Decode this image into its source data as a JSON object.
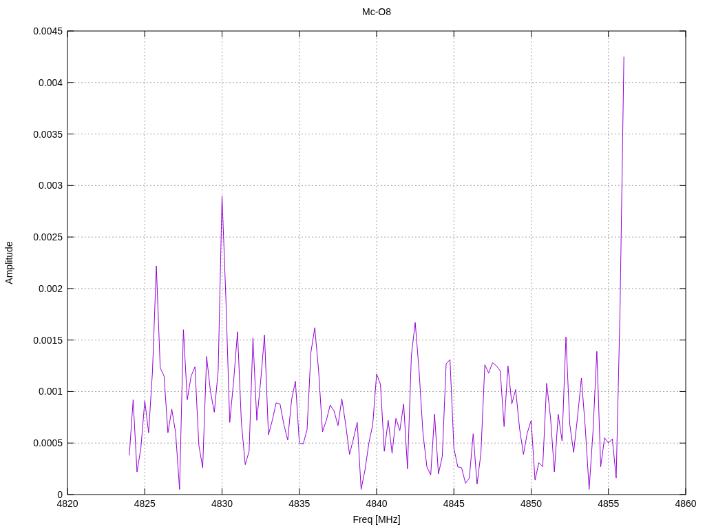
{
  "chart": {
    "chart_data": {
      "type": "line",
      "title": "Mc-O8",
      "xlabel": "Freq [MHz]",
      "ylabel": "Amplitude",
      "grid": true,
      "xlim": [
        4820,
        4860
      ],
      "ylim": [
        0,
        0.0045
      ],
      "xticks": [
        4820,
        4825,
        4830,
        4835,
        4840,
        4845,
        4850,
        4855,
        4860
      ],
      "yticks": [
        0,
        0.0005,
        0.001,
        0.0015,
        0.002,
        0.0025,
        0.003,
        0.0035,
        0.004,
        0.0045
      ],
      "x": [
        4824,
        4824.25,
        4824.5,
        4824.75,
        4825,
        4825.25,
        4825.5,
        4825.75,
        4826,
        4826.25,
        4826.5,
        4826.75,
        4827,
        4827.25,
        4827.5,
        4827.75,
        4828,
        4828.25,
        4828.5,
        4828.75,
        4829,
        4829.25,
        4829.5,
        4829.75,
        4830,
        4830.25,
        4830.5,
        4830.75,
        4831,
        4831.25,
        4831.5,
        4831.75,
        4832,
        4832.25,
        4832.5,
        4832.75,
        4833,
        4833.25,
        4833.5,
        4833.75,
        4834,
        4834.25,
        4834.5,
        4834.75,
        4835,
        4835.25,
        4835.5,
        4835.75,
        4836,
        4836.25,
        4836.5,
        4836.75,
        4837,
        4837.25,
        4837.5,
        4837.75,
        4838,
        4838.25,
        4838.5,
        4838.75,
        4839,
        4839.25,
        4839.5,
        4839.75,
        4840,
        4840.25,
        4840.5,
        4840.75,
        4841,
        4841.25,
        4841.5,
        4841.75,
        4842,
        4842.25,
        4842.5,
        4842.75,
        4843,
        4843.25,
        4843.5,
        4843.75,
        4844,
        4844.25,
        4844.5,
        4844.75,
        4845,
        4845.25,
        4845.5,
        4845.75,
        4846,
        4846.25,
        4846.5,
        4846.75,
        4847,
        4847.25,
        4847.5,
        4847.75,
        4848,
        4848.25,
        4848.5,
        4848.75,
        4849,
        4849.25,
        4849.5,
        4849.75,
        4850,
        4850.25,
        4850.5,
        4850.75,
        4851,
        4851.25,
        4851.5,
        4851.75,
        4852,
        4852.25,
        4852.5,
        4852.75,
        4853,
        4853.25,
        4853.5,
        4853.75,
        4854,
        4854.25,
        4854.5,
        4854.75,
        4855,
        4855.25,
        4855.5,
        4855.75,
        4856
      ],
      "series": [
        {
          "color": "#9400d3",
          "values": [
            0.00038,
            0.00092,
            0.00022,
            0.00045,
            0.00091,
            0.0006,
            0.0012,
            0.00222,
            0.00123,
            0.00115,
            0.0006,
            0.00083,
            0.0006,
            5e-05,
            0.0016,
            0.00092,
            0.00115,
            0.00124,
            0.00048,
            0.00026,
            0.00134,
            0.001,
            0.0008,
            0.0012,
            0.0029,
            0.0019,
            0.0007,
            0.0011,
            0.00158,
            0.0007,
            0.00029,
            0.00042,
            0.00152,
            0.00072,
            0.0011,
            0.00155,
            0.00058,
            0.00072,
            0.00089,
            0.00088,
            0.00068,
            0.00053,
            0.00092,
            0.0011,
            0.0005,
            0.00049,
            0.00063,
            0.00138,
            0.00162,
            0.0012,
            0.00061,
            0.00072,
            0.00087,
            0.00081,
            0.00067,
            0.00093,
            0.00068,
            0.00039,
            0.00054,
            0.0007,
            5e-05,
            0.00024,
            0.0005,
            0.00068,
            0.00117,
            0.00107,
            0.00042,
            0.00072,
            0.0004,
            0.00074,
            0.00062,
            0.00088,
            0.00025,
            0.00135,
            0.00167,
            0.0012,
            0.0006,
            0.00027,
            0.00019,
            0.00078,
            0.0002,
            0.00037,
            0.00127,
            0.00131,
            0.00045,
            0.00027,
            0.00026,
            0.00011,
            0.00016,
            0.00059,
            0.0001,
            0.0004,
            0.00126,
            0.00118,
            0.00128,
            0.00125,
            0.0012,
            0.00066,
            0.00125,
            0.00088,
            0.00102,
            0.00064,
            0.00039,
            0.0006,
            0.00072,
            0.00014,
            0.00031,
            0.00027,
            0.00108,
            0.00075,
            0.00022,
            0.00078,
            0.00052,
            0.00153,
            0.00068,
            0.00041,
            0.00075,
            0.00113,
            0.00065,
            5e-05,
            0.00061,
            0.00139,
            0.00027,
            0.00055,
            0.0005,
            0.00054,
            0.00016,
            0.0018,
            0.00425
          ]
        }
      ]
    }
  }
}
